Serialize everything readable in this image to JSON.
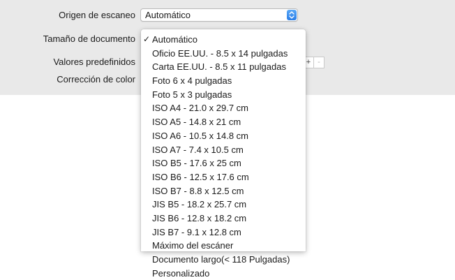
{
  "settings": {
    "scan_source": {
      "label": "Origen de escaneo",
      "value": "Automático"
    },
    "document_size": {
      "label": "Tamaño de documento"
    },
    "presets": {
      "label": "Valores predefinidos",
      "add_label": "+",
      "remove_label": "-"
    },
    "color_correction": {
      "label": "Corrección de color"
    }
  },
  "dropdown": {
    "check_glyph": "✓",
    "selected_index": 0,
    "items": [
      {
        "label": "Automático"
      },
      {
        "label": "Oficio EE.UU. - 8.5 x 14 pulgadas"
      },
      {
        "label": "Carta EE.UU. - 8.5 x 11 pulgadas"
      },
      {
        "label": "Foto 6 x 4 pulgadas"
      },
      {
        "label": "Foto 5 x 3 pulgadas"
      },
      {
        "label": "ISO A4 - 21.0 x 29.7 cm"
      },
      {
        "label": "ISO A5 - 14.8 x 21 cm"
      },
      {
        "label": "ISO A6 - 10.5 x 14.8 cm"
      },
      {
        "label": "ISO A7 - 7.4 x 10.5 cm"
      },
      {
        "label": "ISO B5 - 17.6 x 25 cm"
      },
      {
        "label": "ISO B6 - 12.5 x 17.6 cm"
      },
      {
        "label": "ISO B7 - 8.8 x 12.5 cm"
      },
      {
        "label": "JIS B5 - 18.2 x 25.7 cm"
      },
      {
        "label": "JIS B6 - 12.8 x 18.2 cm"
      },
      {
        "label": "JIS B7 - 9.1 x 12.8 cm"
      },
      {
        "label": "Máximo del escáner"
      },
      {
        "label": "Documento largo(< 118 Pulgadas)"
      },
      {
        "label": "Personalizado"
      }
    ]
  },
  "colors": {
    "panel_background": "#e9e9e9",
    "stepper_accent": "#2a7ee8"
  },
  "icons": {
    "select_stepper": "chevron-up-down-icon",
    "selected_marker": "checkmark-icon"
  }
}
